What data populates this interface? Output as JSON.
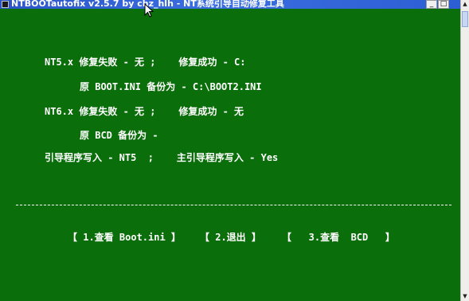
{
  "window": {
    "title": "NTBOOTautofix v2.5.7 by chz_hlh - NT系统引导自动修复工具",
    "minimize_label": "_",
    "maximize_label": "□"
  },
  "console": {
    "nt5_repair": "NT5.x 修复失败 - 无 ;    修复成功 - C:",
    "nt5_backup": "原 BOOT.INI 备份为 - C:\\BOOT2.INI",
    "nt6_repair": "NT6.x 修复失败 - 无 ;    修复成功 - 无",
    "nt6_backup": "原 BCD 备份为 -",
    "boot_write": "引导程序写入 - NT5  ;    主引导程序写入 - Yes"
  },
  "menu": {
    "items": [
      {
        "label": "【 1.查看 Boot.ini 】"
      },
      {
        "label": "【 2.退出 】"
      },
      {
        "label": "【   3.查看  BCD   】"
      }
    ]
  },
  "scrollbar": {
    "up_arrow": "▲",
    "down_arrow": "▼"
  },
  "colors": {
    "console_background": "#0a6e0a",
    "console_text": "#ffffff",
    "titlebar": "#2c55c9"
  },
  "icons": {
    "app": "console-app-icon",
    "cursor": "mouse-pointer-icon"
  }
}
